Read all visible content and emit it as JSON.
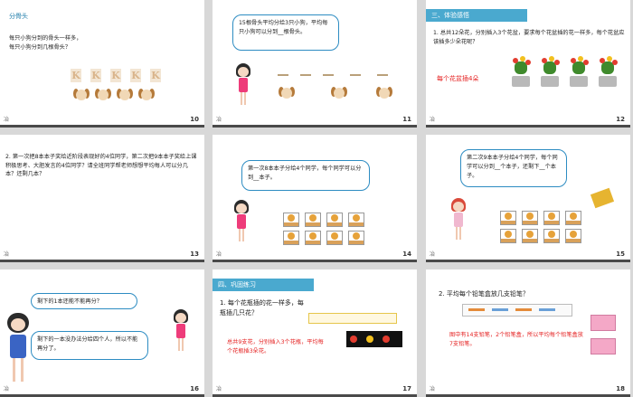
{
  "slides": [
    {
      "number": "10",
      "title": "分骨头",
      "lines": [
        "每只小狗分到的骨头一样多，",
        "每只小狗分到几根骨头？"
      ],
      "mark": "冶"
    },
    {
      "number": "11",
      "bubble": "15根骨头平均分给3只小狗，平均每只小狗可以分到__根骨头。",
      "mark": "冶"
    },
    {
      "number": "12",
      "header": "三、体验感悟",
      "question": "1. 总共12朵花，分别插入3个花盆，要求每个花盆插的花一样多，每个花盆应该插多少朵花呢？",
      "answer": "每个花盆插4朵",
      "mark": "冶"
    },
    {
      "number": "13",
      "text": "2. 第一次把8本本子奖给近阶段表现好的4位同学，第二次把9本本子奖给上课积极思考、大胆发言的4位同学？请全班同学帮老师想想平均每人可以分几本？还剩几本？",
      "mark": "冶"
    },
    {
      "number": "14",
      "bubble": "第一次8本本子分给4个同学，每个同学可以分到__本子。",
      "mark": "冶"
    },
    {
      "number": "15",
      "bubble": "第二次9本本子分给4个同学，每个同学可以分到__个本子，还剩下__个本子。",
      "mark": "冶"
    },
    {
      "number": "16",
      "bubble1": "剩下的1本还能不能再分？",
      "bubble2": "剩下的一本没办法分给四个人，所以不能再分了。",
      "mark": "冶"
    },
    {
      "number": "17",
      "header": "四、巩固练习",
      "question": "1. 每个花瓶插的花一样多，每瓶插几只花？",
      "answer": "总共9支花，分别插入3个花瓶，平均每个花瓶插3朵花。",
      "mark": "冶"
    },
    {
      "number": "18",
      "question": "2. 平均每个铅笔盒放几支铅笔？",
      "answer": "图中有14支铅笔，2个铅笔盒，所以平均每个铅笔盒放7支铅笔。",
      "mark": "冶"
    }
  ]
}
